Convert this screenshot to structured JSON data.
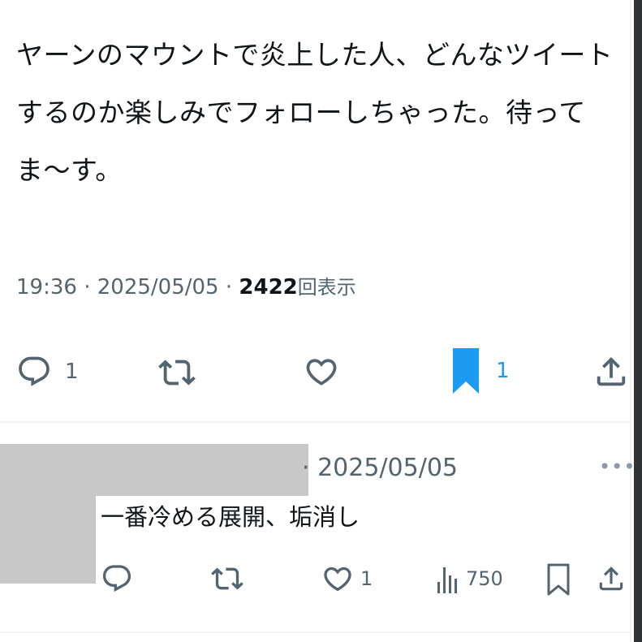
{
  "main_tweet": {
    "text": "ヤーンのマウントで炎上した人、どんなツイートするのか楽しみでフォローしちゃった。待ってま〜す。",
    "time": "19:36",
    "separator": " · ",
    "date": "2025/05/05",
    "views_count": "2422",
    "views_label": "回表示",
    "actions": {
      "reply_count": "1",
      "retweet_count": "",
      "like_count": "",
      "bookmark_count": "1"
    }
  },
  "reply": {
    "date_prefix": "· ",
    "date": "2025/05/05",
    "more_label": "•••",
    "text": "一番冷める展開、垢消し",
    "actions": {
      "reply_count": "",
      "retweet_count": "",
      "like_count": "1",
      "views_count": "750"
    }
  },
  "colors": {
    "text": "#0f1419",
    "secondary": "#536471",
    "bookmark_active": "#1d9bf0",
    "divider": "#eff3f4",
    "redaction": "#c8c8c8"
  },
  "icons": [
    "reply-icon",
    "retweet-icon",
    "like-icon",
    "bookmark-icon",
    "share-icon",
    "views-icon",
    "more-icon"
  ]
}
